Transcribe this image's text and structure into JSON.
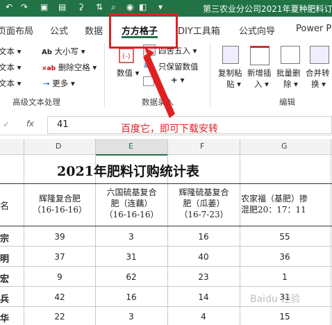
{
  "window": {
    "title": "第三农业分公司2021年夏种肥料订"
  },
  "tabs": {
    "t0": "页面布局",
    "t1": "公式",
    "t2": "数据",
    "t3": "方方格子",
    "t4": "DIY工具箱",
    "t5": "公式向导",
    "t6": "Power Pi"
  },
  "ribbon": {
    "text_row1": "文本",
    "text_row2": "文本",
    "text_row3": "文本",
    "upper": "大小写",
    "del_space": "删除空格",
    "more": "更多",
    "group_text": "高级文本处理",
    "numval": "数值",
    "round": "四舍五入",
    "keep_num": "只保留数值",
    "group_data": "数据录入",
    "copy_paste_1": "复制粘",
    "copy_paste_2": "贴",
    "insert_1": "新增插",
    "insert_2": "入",
    "batch_del_1": "批量删",
    "batch_del_2": "除",
    "merge_1": "合并转",
    "merge_2": "换",
    "group_edit": "编辑"
  },
  "formula": {
    "fx": "fx",
    "value": "41"
  },
  "columns": [
    "D",
    "E",
    "F",
    "G"
  ],
  "sheet": {
    "title": "2021年肥料订购统计表",
    "row_header_label": "名",
    "headers": [
      {
        "l1": "辉隆复合肥",
        "l2": "（16-16-16）",
        "l3": ""
      },
      {
        "l1": "六国硫基复合",
        "l2": "肥（连藕）",
        "l3": "（16-16-16）"
      },
      {
        "l1": "辉隆硫基复合",
        "l2": "肥（瓜蒌）",
        "l3": "（16-7-23）"
      },
      {
        "l1": "农家福（基肥）掺",
        "l2": "混肥20：17：11",
        "l3": ""
      }
    ],
    "rows": [
      {
        "name": "宗",
        "d": "39",
        "e": "3",
        "f": "16",
        "g": "55"
      },
      {
        "name": "明",
        "d": "37",
        "e": "31",
        "f": "40",
        "g": "36"
      },
      {
        "name": "宏",
        "d": "9",
        "e": "62",
        "f": "23",
        "g": "1"
      },
      {
        "name": "兵",
        "d": "42",
        "e": "16",
        "f": "14",
        "g": "31"
      },
      {
        "name": "华",
        "d": "22",
        "e": "3",
        "f": "4",
        "g": "15"
      }
    ]
  },
  "annotation": "百度它，即可下载安转",
  "watermark": "Baidu 经验",
  "accent": "#217346",
  "highlight": "#e02020"
}
